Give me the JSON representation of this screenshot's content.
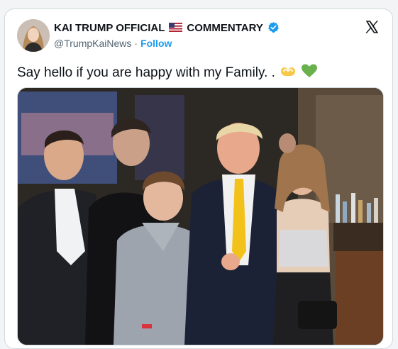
{
  "post": {
    "display_name": "KAI TRUMP OFFICIAL",
    "display_name_suffix": "COMMENTARY",
    "handle": "@TrumpKaiNews",
    "separator": "·",
    "follow_label": "Follow",
    "text": "Say hello if you are happy with my Family. .",
    "icons": {
      "flag": "us-flag-icon",
      "verified": "verified-badge-icon",
      "platform": "x-logo-icon",
      "emoji_1": "heart-hands-emoji",
      "emoji_2": "green-heart-emoji"
    },
    "colors": {
      "accent": "#1d9bf0",
      "text": "#0f1419",
      "muted": "#536471",
      "border": "#cfd9de"
    }
  }
}
